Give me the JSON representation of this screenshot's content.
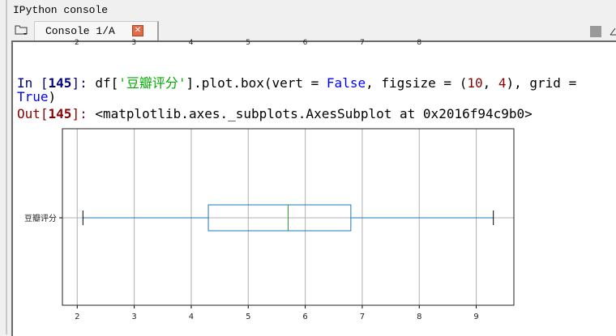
{
  "window": {
    "title": "IPython console"
  },
  "tabs": [
    {
      "label": "Console 1/A",
      "close_icon": "close-icon"
    }
  ],
  "toolbar": {
    "stop_icon": "stop-icon",
    "options_icon": "options-icon",
    "browse_icon": "folder-icon"
  },
  "clipped_ticks": [
    "2",
    "3",
    "4",
    "5",
    "6",
    "7",
    "8"
  ],
  "cell": {
    "in_prompt": "In [",
    "in_num": "145",
    "in_close": "]: ",
    "code_a": "df[",
    "code_str": "'豆瓣评分'",
    "code_b": "].plot.box(vert = ",
    "code_false": "False",
    "code_c": ", figsize = (",
    "code_10": "10",
    "code_d": ", ",
    "code_4": "4",
    "code_e": "), grid =",
    "code_true": "True",
    "code_f": ")",
    "out_prompt": "Out[",
    "out_num": "145",
    "out_close": "]: ",
    "out_text": "<matplotlib.axes._subplots.AxesSubplot at 0x2016f94c9b0>"
  },
  "chart_data": {
    "type": "box",
    "orientation": "horizontal",
    "grid": true,
    "categories": [
      "豆瓣评分"
    ],
    "boxes": [
      {
        "name": "豆瓣评分",
        "whisker_low": 2.1,
        "q1": 4.3,
        "median": 5.7,
        "q3": 6.8,
        "whisker_high": 9.3
      }
    ],
    "xlim": [
      1.74,
      9.66
    ],
    "xticks": [
      2,
      3,
      4,
      5,
      6,
      7,
      8,
      9
    ],
    "colors": {
      "box": "#1f77b4",
      "median": "#2ca02c",
      "cap": "#000000",
      "grid": "#b0b0b0"
    }
  }
}
